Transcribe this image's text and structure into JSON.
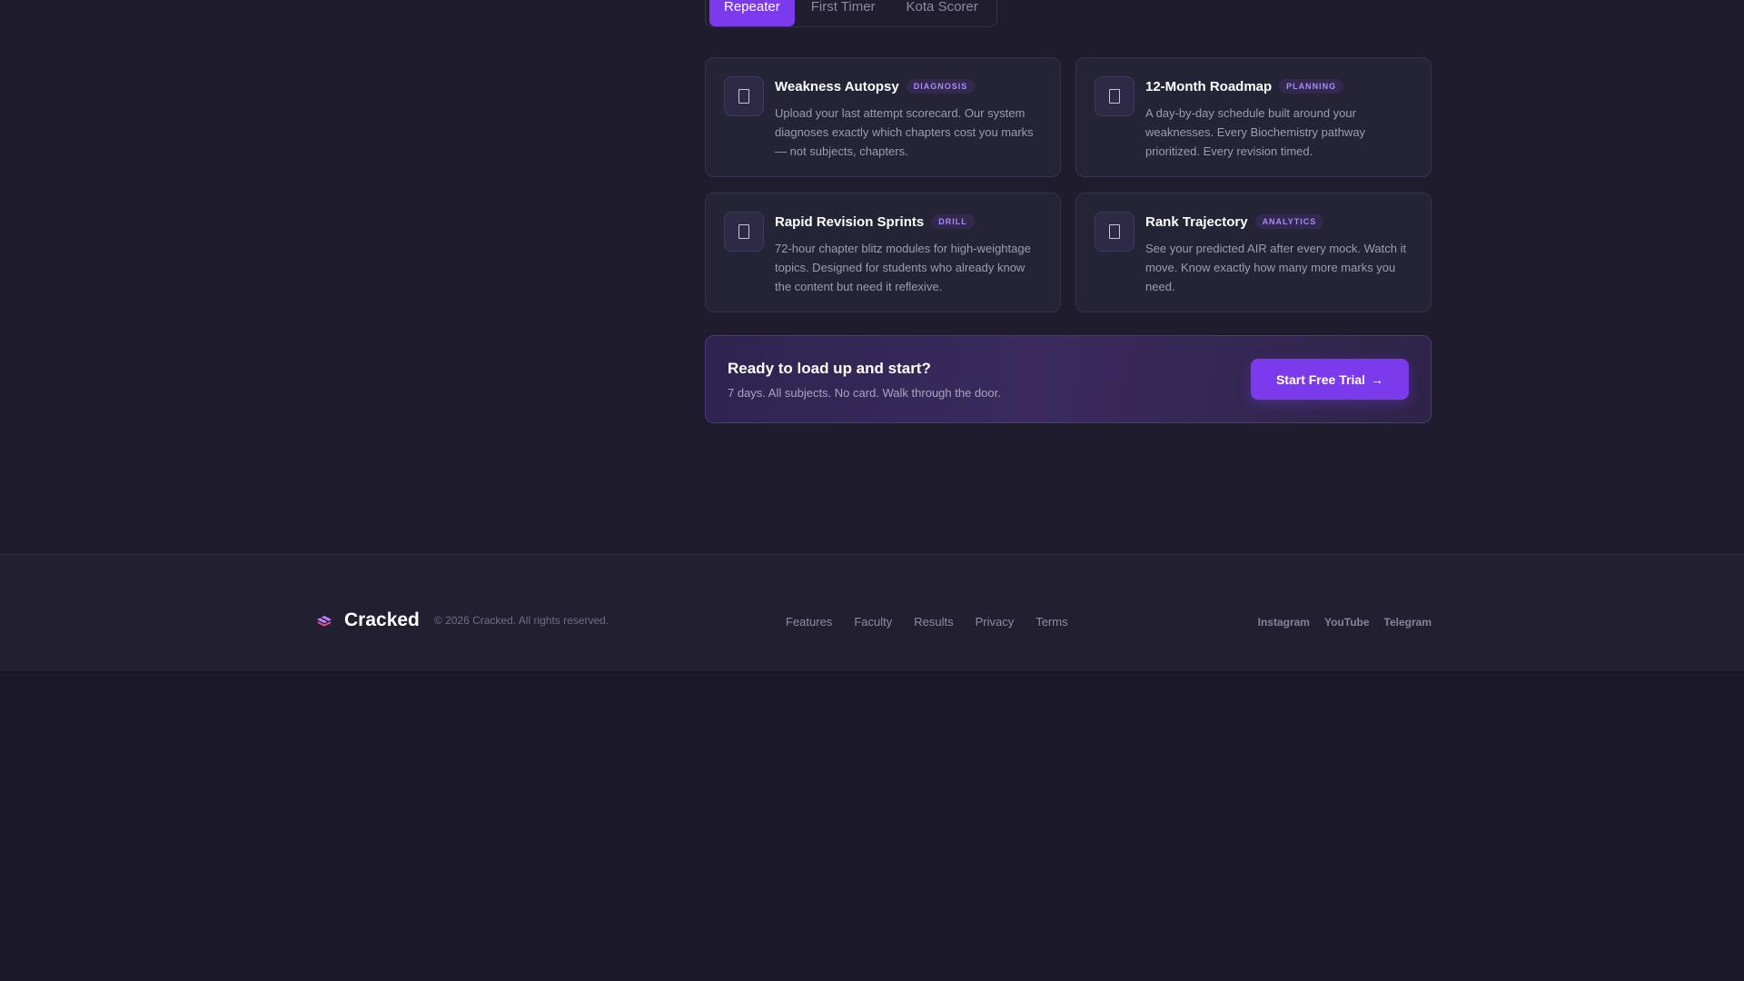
{
  "tabs": [
    {
      "label": "Repeater",
      "active": true
    },
    {
      "label": "First Timer",
      "active": false
    },
    {
      "label": "Kota Scorer",
      "active": false
    }
  ],
  "cards": [
    {
      "title": "Weakness Autopsy",
      "badge": "DIAGNOSIS",
      "icon": "document-icon",
      "description": "Upload your last attempt scorecard. Our system diagnoses exactly which chapters cost you marks — not subjects, chapters."
    },
    {
      "title": "12-Month Roadmap",
      "badge": "PLANNING",
      "icon": "document-icon",
      "description": "A day-by-day schedule built around your weaknesses. Every Biochemistry pathway prioritized. Every revision timed."
    },
    {
      "title": "Rapid Revision Sprints",
      "badge": "DRILL",
      "icon": "document-icon",
      "description": "72-hour chapter blitz modules for high-weightage topics. Designed for students who already know the content but need it reflexive."
    },
    {
      "title": "Rank Trajectory",
      "badge": "ANALYTICS",
      "icon": "document-icon",
      "description": "See your predicted AIR after every mock. Watch it move. Know exactly how many more marks you need."
    }
  ],
  "cta": {
    "title": "Ready to load up and start?",
    "subtitle": "7 days. All subjects. No card. Walk through the door.",
    "button_label": "Start Free Trial",
    "button_arrow": "→"
  },
  "footer": {
    "brand": "Cracked",
    "copyright": "© 2026 Cracked. All rights reserved.",
    "nav": [
      "Features",
      "Faculty",
      "Results",
      "Privacy",
      "Terms"
    ],
    "social": [
      "Instagram",
      "YouTube",
      "Telegram"
    ]
  },
  "colors": {
    "accent": "#7c3aed",
    "badge_text": "#a78bfa",
    "background": "#1a1827"
  }
}
